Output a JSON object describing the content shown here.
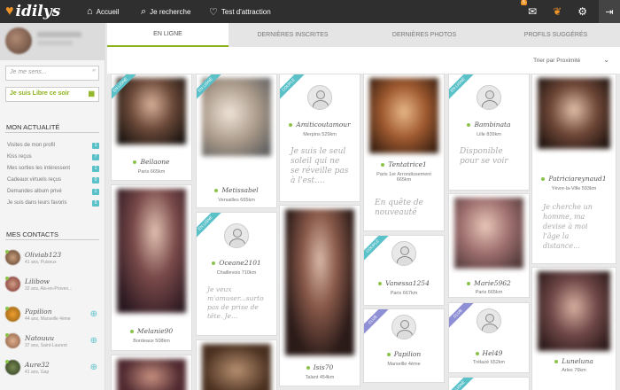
{
  "app": {
    "logo": "idilys"
  },
  "nav": {
    "accueil": "Accueil",
    "recherche": "Je recherche",
    "test": "Test d'attraction"
  },
  "topbar": {
    "mail_badge": "5"
  },
  "sidebar": {
    "mood_placeholder": "Je me sens...",
    "libre": "Je suis Libre ce soir",
    "actu_title": "MON ACTUALITÉ",
    "actu": [
      {
        "label": "Visites de mon profil",
        "count": "1"
      },
      {
        "label": "Kiss reçus",
        "count": "7"
      },
      {
        "label": "Mes sorties les intéressent",
        "count": "1"
      },
      {
        "label": "Cadeaux virtuels reçus",
        "count": "0"
      },
      {
        "label": "Demandes album privé",
        "count": "1"
      },
      {
        "label": "Je suis dans leurs favoris",
        "count": "5"
      }
    ],
    "contacts_title": "MES CONTACTS",
    "contacts": [
      {
        "name": "Oliviab123",
        "info": "41 ans, Puiseux"
      },
      {
        "name": "Lilibow",
        "info": "32 ans, Aix-en-Proven..."
      },
      {
        "name": "Papilion",
        "info": "44 ans, Marseille 4ème"
      },
      {
        "name": "Natouuu",
        "info": "37 ans, Saint-Laurent"
      },
      {
        "name": "Aure32",
        "info": "41 ans, Gap"
      }
    ]
  },
  "tabs": [
    "EN LIGNE",
    "DERNIÈRES INSCRITES",
    "DERNIÈRES PHOTOS",
    "PROFILS SUGGÉRÉS"
  ],
  "sort": {
    "label": "Trier par Proximité"
  },
  "ribbons": {
    "online": "EN LIGNE",
    "couple": "COUPLE",
    "club": "CLUB"
  },
  "cards": {
    "bellaone": {
      "name": "Bellaone",
      "loc": "Paris 665km"
    },
    "melanie": {
      "name": "Melanie90",
      "loc": "Bordeaux 508km"
    },
    "metissabel": {
      "name": "Metissabel",
      "loc": "Versailles 665km"
    },
    "oceane": {
      "name": "Oceane2101",
      "loc": "Chaillevois 710km",
      "quote": "Je veux m'amuser...surto pas de prise de tête. Je..."
    },
    "amitie": {
      "name": "Amiticoutamour",
      "loc": "Merpins 529km",
      "quote": "Je suis le seul soleil qui ne se réveille pas à l'est...."
    },
    "isis": {
      "name": "Isis70",
      "loc": "Talant 454km"
    },
    "tentatrice": {
      "name": "Tentatrice1",
      "loc": "Paris 1er Arrondissement 665km",
      "quote": "En quête de nouveauté"
    },
    "vanessa": {
      "name": "Vanessa1254",
      "loc": "Paris 667km"
    },
    "papilion": {
      "name": "Papilion",
      "loc": "Marseille 4ème"
    },
    "bambinata": {
      "name": "Bambinata",
      "loc": "Lille 839km",
      "quote": "Disponible pour se voir"
    },
    "marie": {
      "name": "Marie5962",
      "loc": "Paris 665km"
    },
    "hel": {
      "name": "Hel49",
      "loc": "Trélazé 652km"
    },
    "patricia": {
      "name": "Patriciareynaud1",
      "loc": "Yèvre-la-Ville 593km",
      "quote": "Je cherche un homme, ma devise à moi l'âge la distance..."
    },
    "luneluna": {
      "name": "Luneluna",
      "loc": "Arles 76km"
    }
  },
  "colors": {
    "accent_green": "#8bb21a",
    "teal": "#5bc1c9",
    "topbar": "#2f2f2f",
    "orange": "#f19427"
  }
}
